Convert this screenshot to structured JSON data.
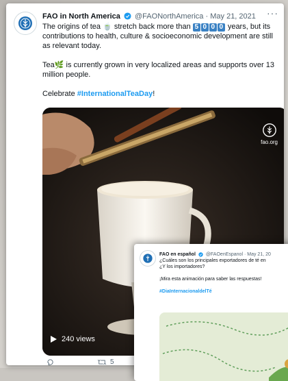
{
  "tweet": {
    "author_name": "FAO in North America",
    "handle": "@FAONorthAmerica",
    "separator": "·",
    "date": "May 21, 2021",
    "more": "···",
    "line1_pre": "The origins of tea ",
    "line1_mid": " stretch back more than ",
    "number_digits": [
      "5",
      "0",
      "0",
      "0"
    ],
    "line1_post": " years, but its contributions to health, culture & socioeconomic development are still as relevant today.",
    "para2_pre": "Tea",
    "para2_post": " is currently grown in very localized areas and supports over 13 million people.",
    "para3_pre": "Celebrate ",
    "hashtag": "#InternationalTeaDay",
    "para3_post": "!"
  },
  "media": {
    "views": "240 views",
    "watermark": "fao.org"
  },
  "actions": {
    "retweets": "5"
  },
  "overlay_tweet": {
    "author_name": "FAO en español",
    "handle": "@FAOenEspanol",
    "separator": "·",
    "date": "May 21, 20",
    "question": "¿Cuáles son los principales exportadores de té en",
    "question2": "¿Y los importadores?",
    "cta": "¡Mira esta animación para saber las respuestas!",
    "hashtag": "#DiaInternacionaldelTé"
  },
  "colors": {
    "link": "#1d9bf0",
    "verified": "#1d9bf0",
    "number_box": "#3b82c4"
  }
}
